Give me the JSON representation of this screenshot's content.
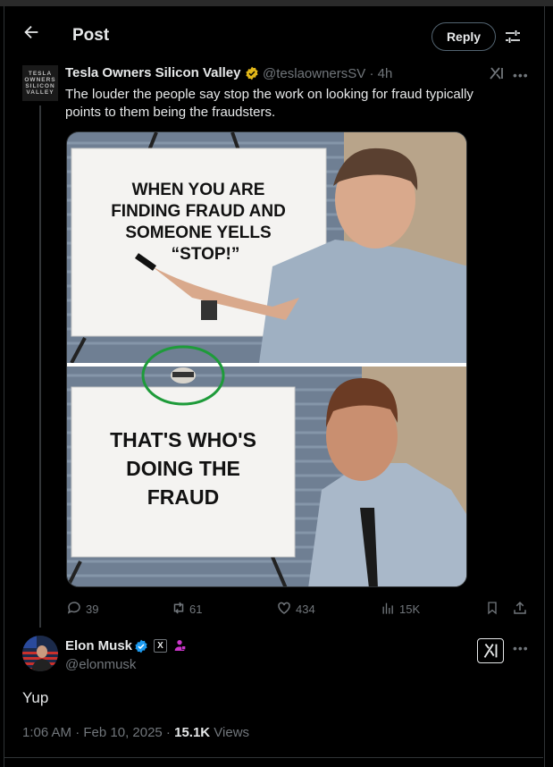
{
  "header": {
    "title": "Post",
    "reply_label": "Reply"
  },
  "tweet": {
    "avatar_text": "TESLA OWNERS SILICON VALLEY",
    "name": "Tesla Owners Silicon Valley",
    "handle": "@teslaownersSV",
    "time": "· 4h",
    "text": "The louder the people say stop the work on looking for fraud typically points to them being the fraudsters.",
    "meme_top": "WHEN YOU ARE FINDING FRAUD AND SOMEONE YELLS “STOP!”",
    "meme_bottom": "THAT'S WHO'S DOING THE FRAUD",
    "stats": {
      "replies": "39",
      "reposts": "61",
      "likes": "434",
      "views": "15K"
    }
  },
  "reply": {
    "name": "Elon Musk",
    "handle": "@elonmusk",
    "text": "Yup",
    "timestamp": "1:06 AM · Feb 10, 2025 · ",
    "views_count": "15.1K",
    "views_label": " Views"
  },
  "colors": {
    "background": "#000000",
    "text": "#e7e9ea",
    "muted": "#71767b",
    "verified_blue": "#1d9bf0",
    "verified_gold": "#e2b719",
    "purple_badge": "#c936c9",
    "circle_green": "#1e9b3a"
  },
  "icons": [
    "back-arrow-icon",
    "adjust-icon",
    "grok-icon",
    "more-icon",
    "reply-icon",
    "repost-icon",
    "like-icon",
    "views-icon",
    "bookmark-icon",
    "share-icon",
    "verified-icon",
    "x-badge-icon",
    "affiliate-icon"
  ]
}
